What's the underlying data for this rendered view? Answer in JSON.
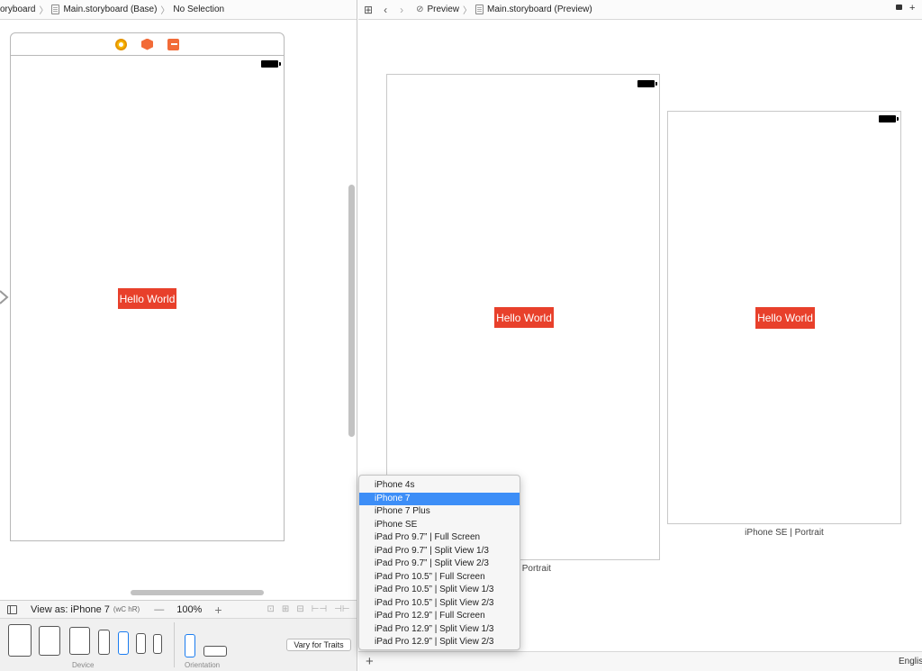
{
  "left_jumpbar": {
    "items": [
      "oryboard",
      "Main.storyboard (Base)",
      "No Selection"
    ]
  },
  "left_scene": {
    "label_text": "Hello World"
  },
  "view_as": {
    "label": "View as: iPhone 7",
    "traits": "(wC hR)",
    "zoom_minus": "—",
    "zoom_level": "100%",
    "zoom_plus": "+"
  },
  "device_bar": {
    "device_label": "Device",
    "orientation_label": "Orientation",
    "vary_button": "Vary for Traits"
  },
  "right_jumpbar": {
    "items": [
      "Preview",
      "Main.storyboard (Preview)"
    ]
  },
  "previews": [
    {
      "label_text": "Hello World",
      "caption": "7 | Portrait"
    },
    {
      "label_text": "Hello World",
      "caption": "iPhone SE | Portrait"
    }
  ],
  "device_menu": {
    "selected": "iPhone 7",
    "items": [
      "iPhone 4s",
      "iPhone 7",
      "iPhone 7 Plus",
      "iPhone SE",
      "iPad Pro 9.7” | Full Screen",
      "iPad Pro 9.7” | Split View 1/3",
      "iPad Pro 9.7” | Split View 2/3",
      "iPad Pro 10.5” | Full Screen",
      "iPad Pro 10.5” | Split View 1/3",
      "iPad Pro 10.5” | Split View 2/3",
      "iPad Pro 12.9” | Full Screen",
      "iPad Pro 12.9” | Split View 1/3",
      "iPad Pro 12.9” | Split View 2/3"
    ]
  },
  "preview_bottom": {
    "add_label": "+",
    "language": "Englis"
  },
  "colors": {
    "label_background": "#e8402b",
    "menu_highlight": "#3d8ef7",
    "selected_device": "#1a7cf0"
  }
}
